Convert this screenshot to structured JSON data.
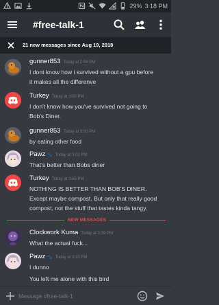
{
  "status_bar": {
    "battery": "29%",
    "time": "3:18 PM"
  },
  "app_bar": {
    "channel": "#free-talk-1"
  },
  "banner": {
    "text": "21 new messages since Aug 19, 2018"
  },
  "messages": [
    {
      "author": "gunner853",
      "timestamp": "Today at 2:59 PM",
      "avatar": "rubber-duck",
      "lines": [
        "I dont know how i survived without a gpu before",
        "it makes all the differenve"
      ]
    },
    {
      "author": "Turkey",
      "timestamp": "Today at 3:00 PM",
      "avatar": "discord-logo",
      "lines": [
        "I don't know how you've survived not going to",
        "Bob's Diner."
      ]
    },
    {
      "author": "gunner853",
      "timestamp": "Today at 3:00 PM",
      "avatar": "rubber-duck",
      "lines": [
        "by eating other food"
      ]
    },
    {
      "author": "Pawz",
      "badge": "🐾",
      "timestamp": "Today at 3:02 PM",
      "avatar": "anime-girl",
      "lines": [
        "That's better than Bobs diner"
      ]
    },
    {
      "author": "Turkey",
      "timestamp": "Today at 3:05 PM",
      "avatar": "discord-logo",
      "lines": [
        "NOTHING IS BETTER THAN BOB'S DINER.",
        "Except maybe compost. But only that really good",
        "compost, not the stuff that tastes kinda tangy."
      ]
    },
    {
      "author": "Clockwork Kuma",
      "timestamp": "Today at 3:09 PM",
      "avatar": "purple-character",
      "lines": [
        "What the actual fuck..."
      ]
    },
    {
      "author": "Pawz",
      "badge": "🐾",
      "timestamp": "Today at 3:10 PM",
      "avatar": "anime-girl",
      "lines": [
        "I dunno",
        "You left me alone with this bird"
      ]
    }
  ],
  "divider": {
    "label": "NEW MESSAGES"
  },
  "composer": {
    "placeholder": "Message #free-talk-1"
  },
  "colors": {
    "background": "#36393f",
    "app_bar": "#2f3136",
    "banner": "#202225",
    "discord_red": "#f04747",
    "text": "#dcddde",
    "muted": "#72767d"
  },
  "icons": [
    "menu-icon",
    "search-icon",
    "members-icon",
    "more-icon",
    "close-icon",
    "plus-icon",
    "emoji-icon",
    "send-icon"
  ]
}
